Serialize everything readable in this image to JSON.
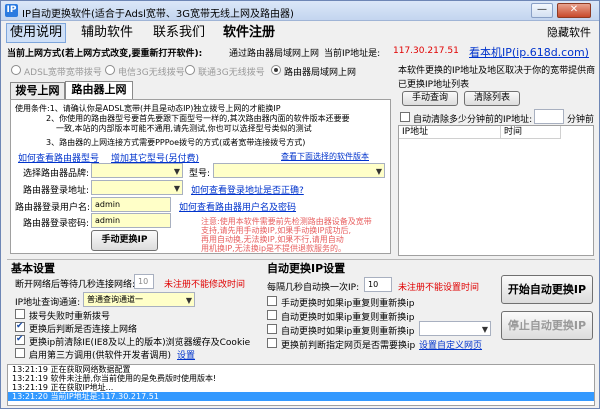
{
  "window": {
    "title": "IP自动更换软件(适合于Adsl宽带、3G宽带无线上网及路由器)",
    "min_glyph": "—",
    "max_glyph": "□",
    "close_glyph": "✕"
  },
  "menu": {
    "items": [
      "使用说明",
      "辅助软件",
      "联系我们",
      "软件注册"
    ],
    "hide_label": "隐藏软件"
  },
  "top": {
    "mode_label": "当前上网方式(若上网方式改变,要重新打开软件):",
    "mode_value": "通过路由器局域网上网",
    "ip_label": "当前IP地址是:",
    "ip_value": "117.30.217.51",
    "site_link": "看本机IP(ip.618d.com)",
    "radios": [
      "ADSL宽带宽带拨号",
      "电信3G无线拨号",
      "联通3G无线拨号",
      "路由器局域网上网"
    ],
    "selected_radio": 3
  },
  "tabs": [
    "拨号上网",
    "路由器上网"
  ],
  "usage": {
    "lines": [
      "使用条件:1、请确认你是ADSL宽带(并且是动态IP)独立拨号上网的才能换IP",
      "2、你使用的路由器型号要首先要跟下面型号一样的,其次路由器内面的软件版本还要要",
      "一致,本站的内部版本可能不通用,请先测试,你也可以选择型号类似的测试",
      "3、路由器的上网连接方式需要PPPoe拨号的方式(或者宽带连接拨号方式)"
    ],
    "link_view_model": "如何查看路由器型号",
    "link_add_model": "增加其它型号(另付费)",
    "link_version": "查看下面选择的软件版本"
  },
  "form": {
    "brand_label": "选择路由器品牌:",
    "model_label": "型号:",
    "addr_label": "路由器登录地址:",
    "addr_link": "如何查看登录地址是否正确?",
    "user_label": "路由器登录用户名:",
    "user_value": "admin",
    "user_link": "如何查看路由器用户名及密码",
    "pwd_label": "路由器登录密码:",
    "pwd_value": "admin",
    "manual_btn": "手动更换IP",
    "note": [
      "注意:使用本软件需要前先检测路由器设备及宽带",
      "支持,请先用手动换IP,如果手动换IP成功后,",
      "再用自动换,无法换IP,如果不行,请用自动",
      "用机换IP,无法换ip是不提供退款服务的。"
    ]
  },
  "right": {
    "desc1": "本软件更换的IP地址及地区取决于你的宽带提供商",
    "desc2": "已更换IP地址列表",
    "query_btn": "手动查询",
    "clear_btn": "清除列表",
    "auto_clear_label": "自动清除多少分钟前的IP地址:",
    "auto_clear_unit": "分钟前",
    "grid_cols": [
      "IP地址",
      "时间"
    ]
  },
  "basic": {
    "title": "基本设置",
    "interval_label": "断开网络后等待几秒连接网络:",
    "interval_value": "10",
    "interval_note": "未注册不能修改时间",
    "query_label": "IP地址查询通道:",
    "query_value": "普通查询通道一",
    "options": [
      {
        "label": "拨号失败时重新拨号",
        "checked": false
      },
      {
        "label": "更换后判断是否连接上网络",
        "checked": true
      },
      {
        "label": "更换ip前清除IE(IE8及以上的版本)浏览器缓存及Cookie",
        "checked": true
      },
      {
        "label": "启用第三方调用(供软件开发者调用)",
        "checked": false
      }
    ],
    "settings_link": "设置"
  },
  "auto": {
    "title": "自动更换IP设置",
    "every_label": "每隔几秒自动换一次IP:",
    "every_value": "10",
    "every_note": "未注册不能设置时间",
    "options": [
      {
        "label": "手动更换时如果ip重复则重新换ip",
        "checked": false
      },
      {
        "label": "自动更换时如果ip重复则重新换ip",
        "checked": false
      },
      {
        "label": "自动更换时如果ip重复则重新换ip",
        "checked": false
      },
      {
        "label": "更换前判断指定网页是否需要换ip",
        "checked": false
      }
    ],
    "custom_link": "设置自定义网页",
    "start_btn": "开始自动更换IP",
    "stop_btn": "停止自动更换IP"
  },
  "log": {
    "lines": [
      "13:21:19 正在获取网络数据配置",
      "13:21:19 软件未注册,你当前使用的是免费版时使用版本!",
      "13:21:19 正在获取IP地址...",
      "13:21:20 当前IP地址是:117.30.217.51"
    ],
    "selected": 3
  },
  "colors": {
    "accent": "#0033cc",
    "warning": "#e00000",
    "field": "#ffffc8",
    "selection": "#3399ff"
  }
}
